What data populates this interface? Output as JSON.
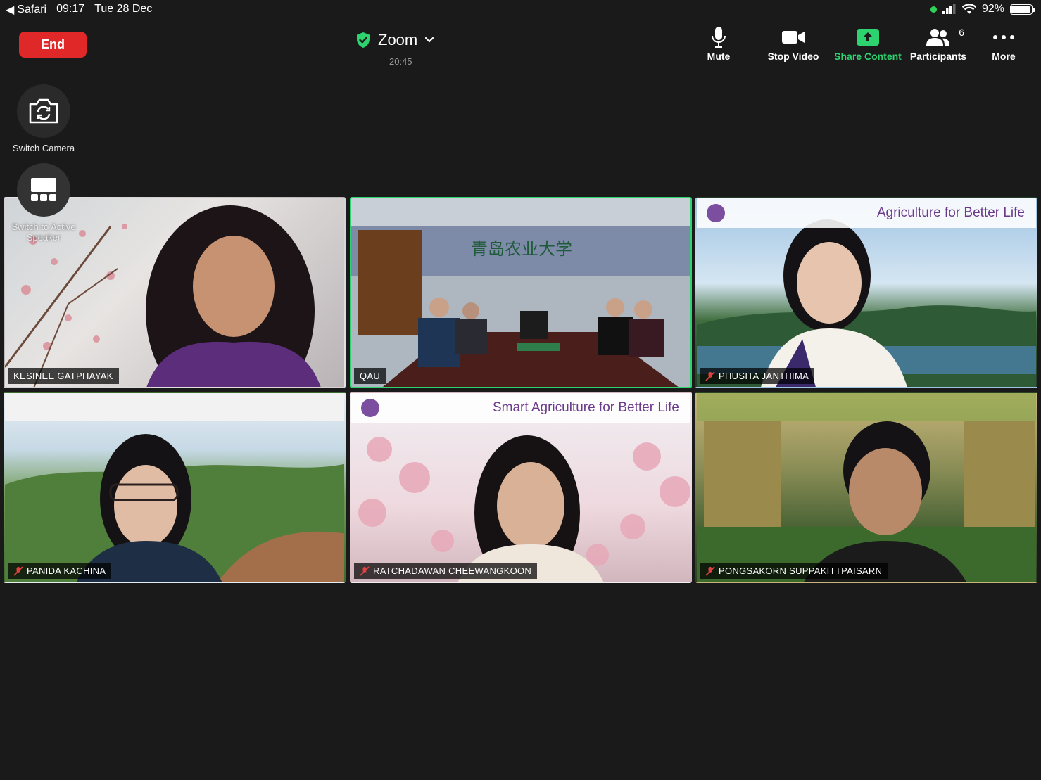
{
  "status_bar": {
    "back_app": "Safari",
    "time": "09:17",
    "date": "Tue 28 Dec",
    "battery": "92%",
    "battery_level": 0.92
  },
  "meeting": {
    "end_label": "End",
    "title": "Zoom",
    "duration": "20:45"
  },
  "toolbar": {
    "mute": "Mute",
    "stop_video": "Stop Video",
    "share_content": "Share Content",
    "participants": "Participants",
    "participants_count": "6",
    "more": "More"
  },
  "side_controls": {
    "switch_camera": "Switch Camera",
    "switch_active_speaker": "Switch to Active Speaker"
  },
  "tiles": [
    {
      "name": "KESINEE GATPHAYAK",
      "muted": false,
      "active": false
    },
    {
      "name": "QAU",
      "muted": false,
      "active": true
    },
    {
      "name": "PHUSITA JANTHIMA",
      "muted": true,
      "active": false,
      "banner": "Agriculture for Better Life"
    },
    {
      "name": "PANIDA KACHINA",
      "muted": true,
      "active": false
    },
    {
      "name": "RATCHADAWAN CHEEWANGKOON",
      "muted": true,
      "active": false,
      "banner": "Smart Agriculture for Better Life"
    },
    {
      "name": "PONGSAKORN SUPPAKITTPAISARN",
      "muted": true,
      "active": false
    }
  ],
  "colors": {
    "background": "#1a1a1a",
    "end_button": "#e02828",
    "accent_green": "#2dd36f"
  }
}
